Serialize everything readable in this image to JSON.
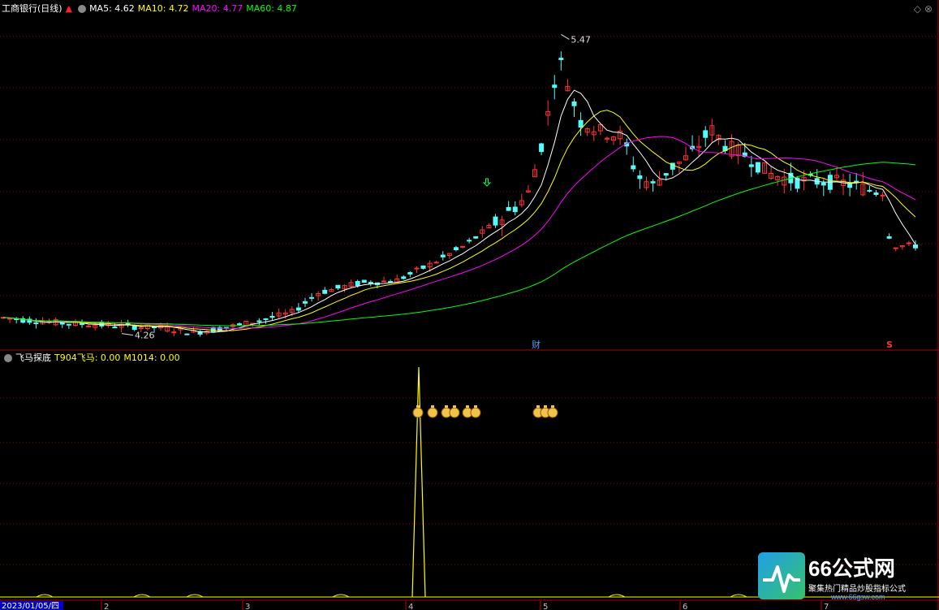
{
  "header": {
    "stock_title": "工商银行(日线)",
    "ma5": "MA5: 4.62",
    "ma10": "MA10: 4.72",
    "ma20": "MA20: 4.77",
    "ma60": "MA60: 4.87"
  },
  "indicator_header": {
    "name": "飞马探底",
    "t904": "T904飞马: 0.00",
    "m1014": "M1014: 0.00"
  },
  "annotations": {
    "high_label": "5.47",
    "low_label": "4.26",
    "fin_marker": "财",
    "sell_marker": "S"
  },
  "date_axis": {
    "start": "2023/01/05/四",
    "months": [
      "2",
      "3",
      "4",
      "5",
      "6",
      "7"
    ]
  },
  "watermark": {
    "title": "66公式网",
    "subtitle": "聚集热门精品炒股指标公式",
    "url": "www.66gsw.com"
  },
  "colors": {
    "background": "#000000",
    "up": "#ff3232",
    "down": "#54fcfc",
    "ma5": "#ffffff",
    "ma10": "#ffff00",
    "ma20": "#ff00ff",
    "ma60": "#00ff00",
    "grid": "#8b0000",
    "indicator": "#ffff00"
  },
  "chart_data": {
    "type": "candlestick",
    "price_ylim": [
      4.2,
      5.55
    ],
    "high": 5.47,
    "low": 4.26,
    "ma_series": [
      {
        "name": "MA5",
        "last": 4.62
      },
      {
        "name": "MA10",
        "last": 4.72
      },
      {
        "name": "MA20",
        "last": 4.77
      },
      {
        "name": "MA60",
        "last": 4.87
      }
    ],
    "indicator": {
      "name": "T904飞马",
      "value": 0.0,
      "m1014": 0.0
    }
  }
}
